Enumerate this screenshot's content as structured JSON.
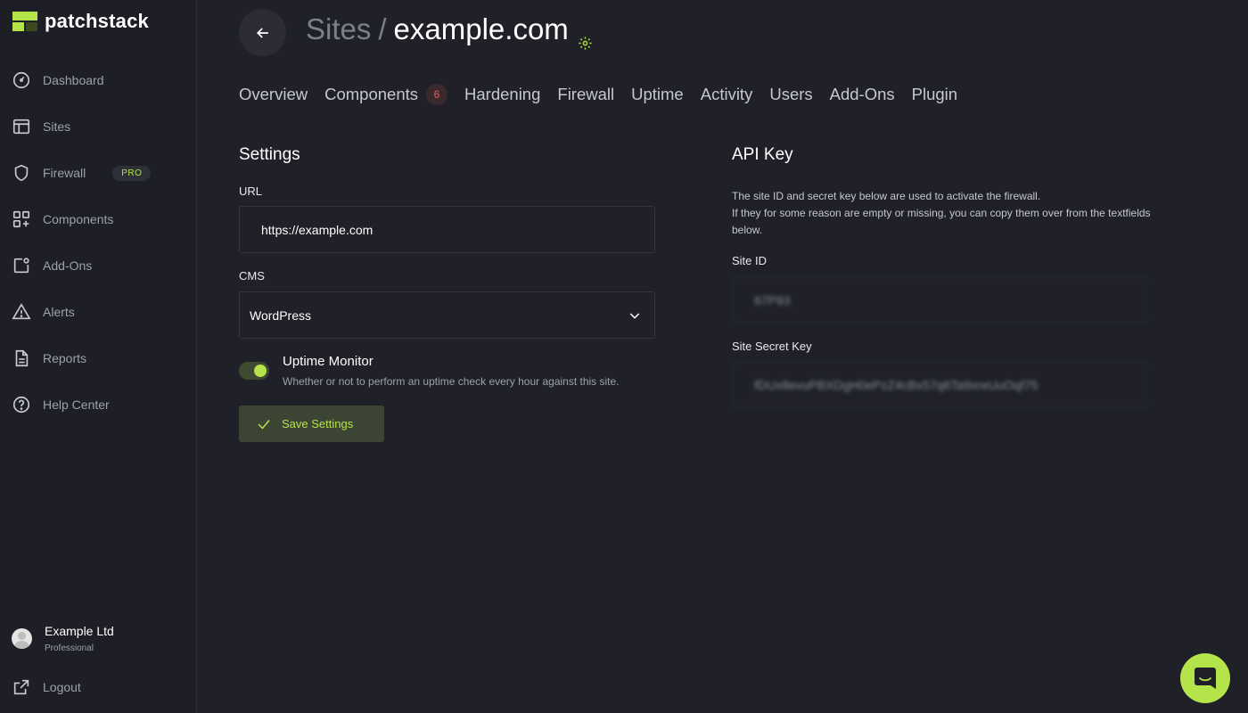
{
  "brand": {
    "name": "patchstack",
    "accent": "#b5e34a"
  },
  "sidebar": {
    "items": [
      {
        "label": "Dashboard",
        "icon": "dashboard-gauge-icon"
      },
      {
        "label": "Sites",
        "icon": "sites-layout-icon"
      },
      {
        "label": "Firewall",
        "icon": "shield-icon",
        "badge": "PRO"
      },
      {
        "label": "Components",
        "icon": "components-grid-plus-icon"
      },
      {
        "label": "Add-Ons",
        "icon": "add-ons-icon"
      },
      {
        "label": "Alerts",
        "icon": "warning-triangle-icon"
      },
      {
        "label": "Reports",
        "icon": "document-icon"
      },
      {
        "label": "Help Center",
        "icon": "help-circle-icon"
      }
    ],
    "account": {
      "name": "Example Ltd",
      "plan": "Professional"
    },
    "logout": "Logout"
  },
  "header": {
    "breadcrumb_parent": "Sites",
    "breadcrumb_sep": "/",
    "breadcrumb_current": "example.com"
  },
  "tabs": [
    {
      "label": "Overview"
    },
    {
      "label": "Components",
      "badge": "6"
    },
    {
      "label": "Hardening"
    },
    {
      "label": "Firewall"
    },
    {
      "label": "Uptime"
    },
    {
      "label": "Activity"
    },
    {
      "label": "Users"
    },
    {
      "label": "Add-Ons"
    },
    {
      "label": "Plugin"
    }
  ],
  "settings": {
    "title": "Settings",
    "url_label": "URL",
    "url_value": "https://example.com",
    "cms_label": "CMS",
    "cms_value": "WordPress",
    "uptime_title": "Uptime Monitor",
    "uptime_desc": "Whether or not to perform an uptime check every hour against this site.",
    "uptime_enabled": true,
    "save_label": "Save Settings"
  },
  "api": {
    "title": "API Key",
    "desc_line1": "The site ID and secret key below are used to activate the firewall.",
    "desc_line2": "If they for some reason are empty or missing, you can copy them over from the textfields below.",
    "site_id_label": "Site ID",
    "site_id_value": "67P93",
    "secret_label": "Site Secret Key",
    "secret_value": "fDUx8evuPBXDgH0ePzZ4cBx57q6Ta9xreUuOqf75"
  }
}
